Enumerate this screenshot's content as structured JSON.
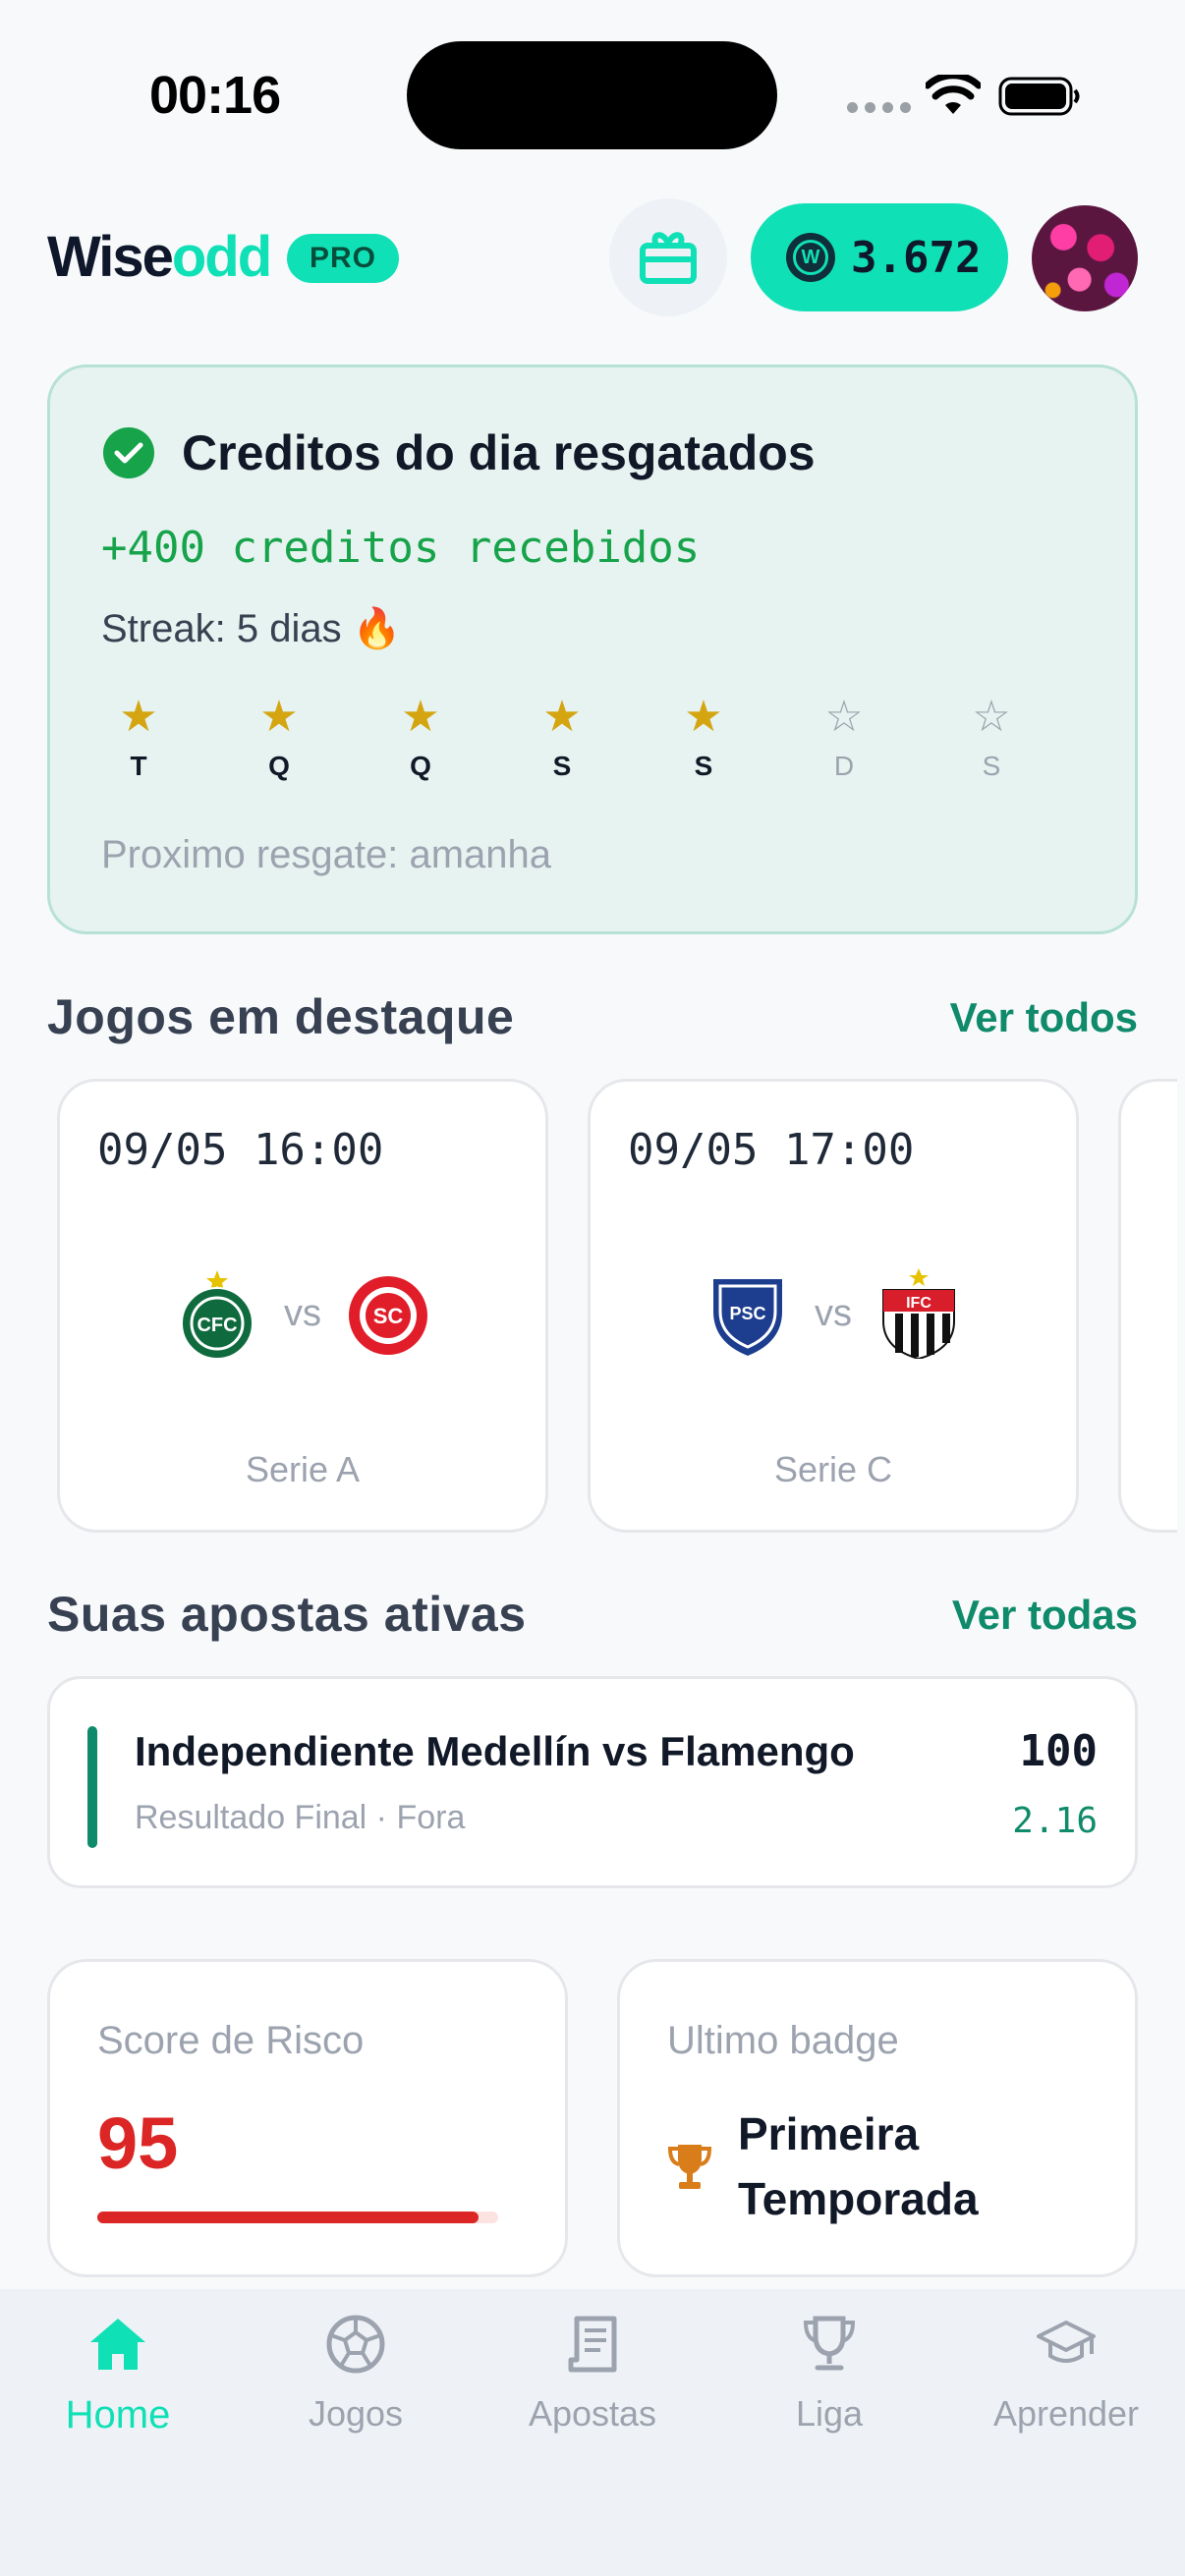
{
  "status_bar": {
    "time": "00:16"
  },
  "header": {
    "brand_part1": "Wise",
    "brand_part2": "odd",
    "pro_label": "PRO",
    "credits": "3.672",
    "coin_letter": "W"
  },
  "daily": {
    "title": "Creditos do dia resgatados",
    "received": "+400 creditos recebidos",
    "streak": "Streak: 5 dias 🔥",
    "days": [
      {
        "label": "T",
        "claimed": true
      },
      {
        "label": "Q",
        "claimed": true
      },
      {
        "label": "Q",
        "claimed": true
      },
      {
        "label": "S",
        "claimed": true
      },
      {
        "label": "S",
        "claimed": true
      },
      {
        "label": "D",
        "claimed": false
      },
      {
        "label": "S",
        "claimed": false
      }
    ],
    "next_claim": "Proximo resgate: amanha"
  },
  "featured": {
    "title": "Jogos em destaque",
    "link": "Ver todos",
    "matches": [
      {
        "datetime": "09/05 16:00",
        "vs": "vs",
        "league": "Serie A",
        "home_crest": "coritiba-crest",
        "away_crest": "internacional-crest",
        "home_initials": "CFC",
        "away_initials": "SC"
      },
      {
        "datetime": "09/05 17:00",
        "vs": "vs",
        "league": "Serie C",
        "home_crest": "paysandu-crest",
        "away_crest": "ituano-crest",
        "home_initials": "PSC",
        "away_initials": "IFC"
      }
    ]
  },
  "active_bets": {
    "title": "Suas apostas ativas",
    "link": "Ver todas",
    "bet": {
      "match": "Independiente Medellín vs Flamengo",
      "market": "Resultado Final · Fora",
      "amount": "100",
      "odds": "2.16"
    }
  },
  "risk": {
    "label": "Score de Risco",
    "value": "95",
    "fraction": 0.95,
    "color": "#dc2626"
  },
  "badge": {
    "label": "Ultimo badge",
    "name": "Primeira Temporada"
  },
  "tabs": [
    {
      "label": "Home",
      "icon": "home-icon",
      "active": true
    },
    {
      "label": "Jogos",
      "icon": "soccer-ball-icon",
      "active": false
    },
    {
      "label": "Apostas",
      "icon": "receipt-icon",
      "active": false
    },
    {
      "label": "Liga",
      "icon": "trophy-icon",
      "active": false
    },
    {
      "label": "Aprender",
      "icon": "graduation-cap-icon",
      "active": false
    }
  ],
  "colors": {
    "accent": "#10e0b6",
    "success": "#16a34a",
    "link": "#0f8a6a",
    "danger": "#dc2626"
  }
}
